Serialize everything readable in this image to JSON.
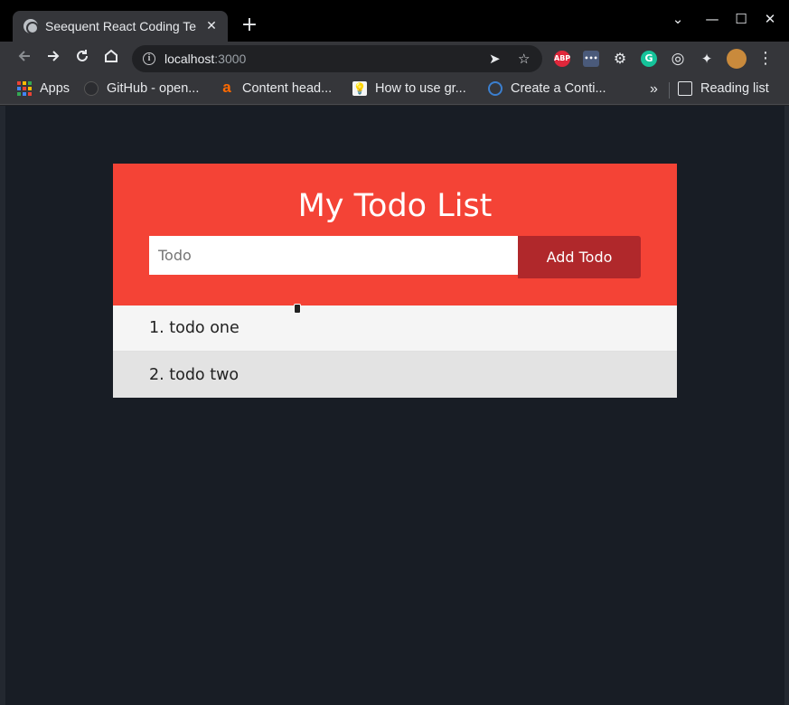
{
  "browser": {
    "tab_title": "Seequent React Coding Te",
    "tab_close": "✕",
    "new_tab": "+",
    "controls": {
      "dropdown": "⌄",
      "minimize": "—",
      "maximize": "☐",
      "close": "✕"
    },
    "address": {
      "host": "localhost",
      "port": ":3000"
    },
    "extensions": [
      {
        "name": "abp-icon",
        "label": "ABP",
        "color": "#e0273b"
      },
      {
        "name": "extension-dots-icon",
        "label": "•••",
        "color": "#4a5a7a"
      },
      {
        "name": "settings-gear-icon",
        "label": "⚙",
        "color": "#5f6368"
      },
      {
        "name": "grammarly-icon",
        "label": "G",
        "color": "#15c39a"
      },
      {
        "name": "target-icon",
        "label": "◎",
        "color": "#5f6368"
      },
      {
        "name": "puzzle-icon",
        "label": "✦",
        "color": "#5f6368"
      },
      {
        "name": "profile-avatar-icon",
        "label": "",
        "color": "#c98a3c"
      }
    ],
    "bookmarks": [
      {
        "label": "Apps"
      },
      {
        "label": "GitHub - open..."
      },
      {
        "label": "Content head..."
      },
      {
        "label": "How to use gr..."
      },
      {
        "label": "Create a Conti..."
      }
    ],
    "bookmarks_overflow": "»",
    "reading_list": "Reading list"
  },
  "app": {
    "title": "My Todo List",
    "input_placeholder": "Todo",
    "add_button": "Add Todo",
    "todos": [
      {
        "text": "1. todo one"
      },
      {
        "text": "2. todo two"
      }
    ],
    "colors": {
      "header": "#f44336",
      "button": "#b0282b",
      "background": "#181d25"
    }
  }
}
